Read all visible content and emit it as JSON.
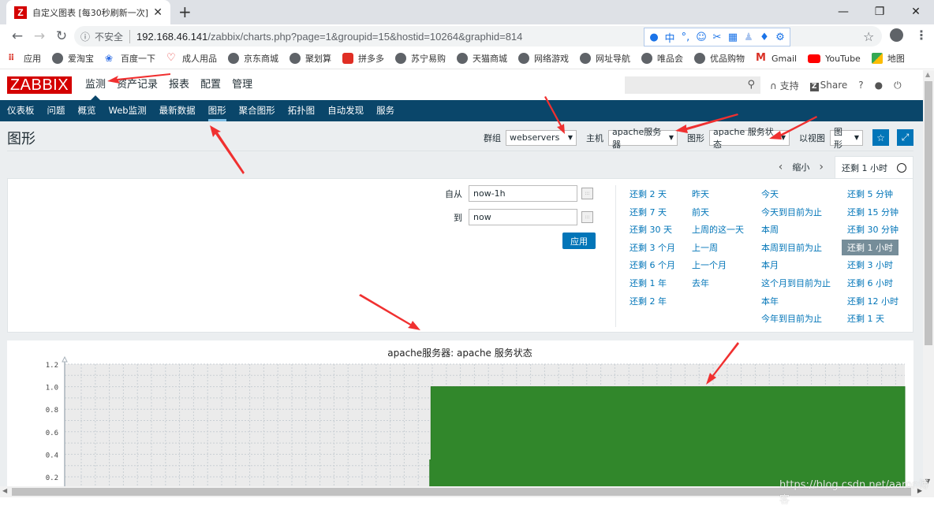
{
  "browser": {
    "tab_title": "自定义图表 [每30秒刷新一次]",
    "tab_favicon": "Z",
    "insecure_label": "不安全",
    "url_host": "192.168.46.141",
    "url_path": "/zabbix/charts.php?page=1&groupid=15&hostid=10264&graphid=814",
    "ime_icons": [
      "user-icon",
      "中",
      "°,",
      "☺",
      "✂",
      "⌨",
      "👤",
      "👕",
      "⚙"
    ],
    "bookmarks": [
      {
        "label": "应用",
        "icon": "apps-icon"
      },
      {
        "label": "爱淘宝",
        "icon": "globe-icon"
      },
      {
        "label": "百度一下",
        "icon": "baidu-icon"
      },
      {
        "label": "成人用品",
        "icon": "heart-icon"
      },
      {
        "label": "京东商城",
        "icon": "globe-icon"
      },
      {
        "label": "聚划算",
        "icon": "globe-icon"
      },
      {
        "label": "拼多多",
        "icon": "pinduoduo-icon"
      },
      {
        "label": "苏宁易购",
        "icon": "globe-icon"
      },
      {
        "label": "天猫商城",
        "icon": "globe-icon"
      },
      {
        "label": "网络游戏",
        "icon": "globe-icon"
      },
      {
        "label": "网址导航",
        "icon": "globe-icon"
      },
      {
        "label": "唯品会",
        "icon": "globe-icon"
      },
      {
        "label": "优品购物",
        "icon": "globe-icon"
      },
      {
        "label": "Gmail",
        "icon": "gmail-icon"
      },
      {
        "label": "YouTube",
        "icon": "youtube-icon"
      },
      {
        "label": "地图",
        "icon": "maps-icon"
      }
    ]
  },
  "zabbix": {
    "logo": "ZABBIX",
    "top_menu": [
      "监测",
      "资产记录",
      "报表",
      "配置",
      "管理"
    ],
    "active_top": 0,
    "support_label": "支持",
    "share_label": "Share",
    "help_label": "?",
    "sub_menu": [
      "仪表板",
      "问题",
      "概览",
      "Web监测",
      "最新数据",
      "图形",
      "聚合图形",
      "拓扑图",
      "自动发现",
      "服务"
    ],
    "active_sub": 5
  },
  "page": {
    "title": "图形",
    "filters": {
      "group_label": "群组",
      "group_value": "webservers",
      "host_label": "主机",
      "host_value": "apache服务器",
      "graph_label": "图形",
      "graph_value": "apache 服务状态",
      "view_label": "以视图",
      "view_value": "图形"
    },
    "timebar": {
      "zoom_out": "缩小",
      "current": "还剩 1 小时"
    },
    "time_filter": {
      "from_label": "自从",
      "from_value": "now-1h",
      "to_label": "到",
      "to_value": "now",
      "apply_label": "应用"
    },
    "quick_ranges": [
      [
        "还剩 2 天",
        "还剩 7 天",
        "还剩 30 天",
        "还剩 3 个月",
        "还剩 6 个月",
        "还剩 1 年",
        "还剩 2 年"
      ],
      [
        "昨天",
        "前天",
        "上周的这一天",
        "上一周",
        "上一个月",
        "去年"
      ],
      [
        "今天",
        "今天到目前为止",
        "本周",
        "本周到目前为止",
        "本月",
        "这个月到目前为止",
        "本年",
        "今年到目前为止"
      ],
      [
        "还剩 5 分钟",
        "还剩 15 分钟",
        "还剩 30 分钟",
        "还剩 1 小时",
        "还剩 3 小时",
        "还剩 6 小时",
        "还剩 12 小时",
        "还剩 1 天"
      ]
    ],
    "selected_quick": "还剩 1 小时"
  },
  "chart_data": {
    "type": "area",
    "title": "apache服务器:  apache  服务状态",
    "ylim": [
      0,
      1.2
    ],
    "yticks": [
      "0.2",
      "0.4",
      "0.6",
      "0.8",
      "1.0",
      "1.2"
    ],
    "ytick_values": [
      0.2,
      0.4,
      0.6,
      0.8,
      1.0,
      1.2
    ],
    "grid": true,
    "series": [
      {
        "name": "apache 服务状态",
        "color": "#31872b",
        "x_fraction": [
          0.0,
          0.4345,
          0.4345,
          0.436,
          0.436,
          1.0
        ],
        "values": [
          null,
          null,
          0.35,
          0.35,
          1.0,
          1.0
        ]
      }
    ],
    "note": "Value is 0/absent for first ~43% of the time window, then steps up to 1.0 for the remainder."
  },
  "watermark": "https://blog.csdn.net/aaron博客"
}
